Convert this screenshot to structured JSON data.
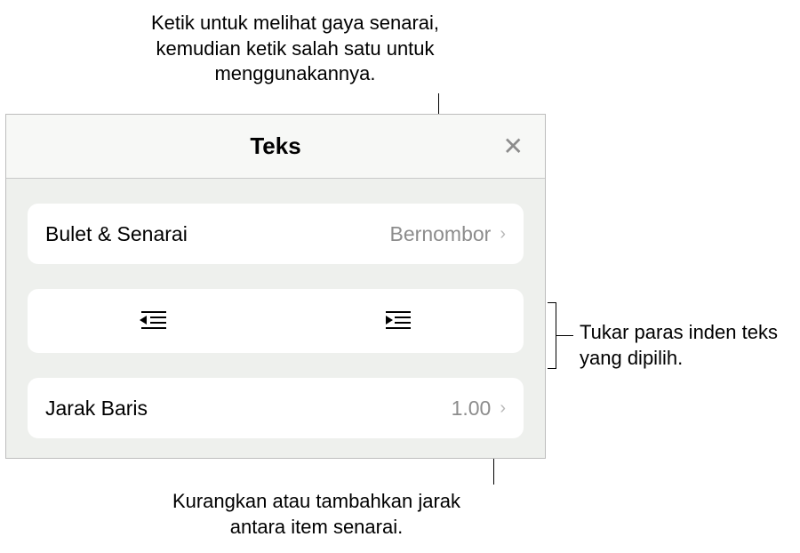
{
  "annotations": {
    "top": "Ketik untuk melihat gaya senarai, kemudian ketik salah satu untuk menggunakannya.",
    "right": "Tukar paras inden teks yang dipilih.",
    "bottom": "Kurangkan atau tambahkan jarak antara item senarai."
  },
  "panel": {
    "title": "Teks",
    "close_icon": "✕"
  },
  "bullets_row": {
    "label": "Bulet & Senarai",
    "value": "Bernombor"
  },
  "spacing_row": {
    "label": "Jarak Baris",
    "value": "1.00"
  },
  "icons": {
    "chevron": "›"
  }
}
